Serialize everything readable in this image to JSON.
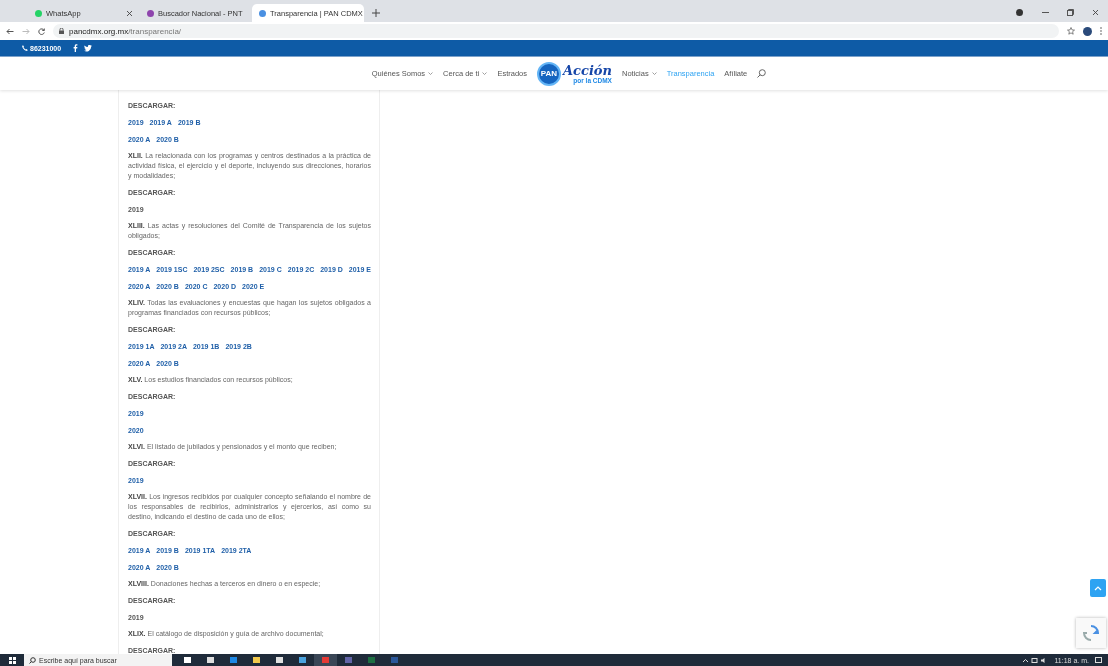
{
  "browser": {
    "tabs": [
      {
        "title": "WhatsApp",
        "selected": false
      },
      {
        "title": "Buscador Nacional - PNT",
        "selected": false
      },
      {
        "title": "Transparencia | PAN CDMX",
        "selected": true
      }
    ],
    "url_host": "pancdmx.org.mx",
    "url_path": "/transparencia/"
  },
  "topbar": {
    "phone": "86231000"
  },
  "nav": {
    "items": [
      {
        "label": "Quiénes Somos",
        "dropdown": true,
        "selected": false
      },
      {
        "label": "Cerca de ti",
        "dropdown": true,
        "selected": false
      },
      {
        "label": "Estrados",
        "dropdown": false,
        "selected": false
      },
      {
        "kind": "logo",
        "badge": "PAN",
        "script": "Acción",
        "tagline": "por la CDMX"
      },
      {
        "label": "Noticias",
        "dropdown": true,
        "selected": false
      },
      {
        "label": "Transparencia",
        "dropdown": false,
        "selected": true
      },
      {
        "label": "Afíliate",
        "dropdown": false,
        "selected": false
      }
    ]
  },
  "sections": [
    {
      "download_label": "DESCARGAR:",
      "rows": [
        [
          {
            "label": "2019",
            "linked": true
          },
          {
            "label": "2019 A",
            "linked": true
          },
          {
            "label": "2019 B",
            "linked": true
          }
        ],
        [
          {
            "label": "2020 A",
            "linked": true
          },
          {
            "label": "2020 B",
            "linked": true
          }
        ]
      ]
    },
    {
      "numeral": "XLII.",
      "text": "La relacionada con los programas y centros destinados a la práctica de actividad física, el ejercicio y el deporte, incluyendo sus direcciones, horarios y modalidades;",
      "download_label": "DESCARGAR:",
      "rows": [
        [
          {
            "label": "2019",
            "linked": false
          }
        ]
      ]
    },
    {
      "numeral": "XLIII.",
      "text": "Las actas y resoluciones del Comité de Transparencia de los sujetos obligados;",
      "download_label": "DESCARGAR:",
      "rows": [
        [
          {
            "label": "2019 A",
            "linked": true
          },
          {
            "label": "2019 1SC",
            "linked": true
          },
          {
            "label": "2019 2SC",
            "linked": true
          },
          {
            "label": "2019 B",
            "linked": true
          },
          {
            "label": "2019 C",
            "linked": true
          },
          {
            "label": "2019 2C",
            "linked": true
          },
          {
            "label": "2019 D",
            "linked": true
          },
          {
            "label": "2019 E",
            "linked": true
          }
        ],
        [
          {
            "label": "2020 A",
            "linked": true
          },
          {
            "label": "2020 B",
            "linked": true
          },
          {
            "label": "2020 C",
            "linked": true
          },
          {
            "label": "2020 D",
            "linked": true
          },
          {
            "label": "2020 E",
            "linked": true
          }
        ]
      ]
    },
    {
      "numeral": "XLIV.",
      "text": "Todas las evaluaciones y encuestas que hagan los sujetos obligados a programas financiados con recursos públicos;",
      "download_label": "DESCARGAR:",
      "rows": [
        [
          {
            "label": "2019 1A",
            "linked": true
          },
          {
            "label": "2019 2A",
            "linked": true
          },
          {
            "label": "2019 1B",
            "linked": true
          },
          {
            "label": "2019 2B",
            "linked": true
          }
        ],
        [
          {
            "label": "2020 A",
            "linked": true
          },
          {
            "label": "2020 B",
            "linked": true
          }
        ]
      ]
    },
    {
      "numeral": "XLV.",
      "text": "Los estudios financiados con recursos públicos;",
      "download_label": "DESCARGAR:",
      "rows": [
        [
          {
            "label": "2019",
            "linked": true
          }
        ],
        [
          {
            "label": "2020",
            "linked": true
          }
        ]
      ]
    },
    {
      "numeral": "XLVI.",
      "text": "El listado de jubilados y pensionados y el monto que reciben;",
      "download_label": "DESCARGAR:",
      "rows": [
        [
          {
            "label": "2019",
            "linked": true
          }
        ]
      ]
    },
    {
      "numeral": "XLVII.",
      "text": "Los ingresos recibidos por cualquier concepto señalando el nombre de los responsables de recibirlos, administrarlos y ejercerlos, así como su destino, indicando el destino de cada uno de ellos;",
      "download_label": "DESCARGAR:",
      "rows": [
        [
          {
            "label": "2019 A",
            "linked": true
          },
          {
            "label": "2019 B",
            "linked": true
          },
          {
            "label": "2019 1TA",
            "linked": true
          },
          {
            "label": "2019 2TA",
            "linked": true
          }
        ],
        [
          {
            "label": "2020 A",
            "linked": true
          },
          {
            "label": "2020 B",
            "linked": true
          }
        ]
      ]
    },
    {
      "numeral": "XLVIII.",
      "text": "Donaciones hechas a terceros en dinero o en especie;",
      "download_label": "DESCARGAR:",
      "rows": [
        [
          {
            "label": "2019",
            "linked": false
          }
        ]
      ]
    },
    {
      "numeral": "XLIX.",
      "text": "El catálogo de disposición y guía de archivo documental;",
      "download_label": "DESCARGAR:"
    }
  ],
  "taskbar": {
    "search_placeholder": "Escribe aquí para buscar",
    "time": "11:18 a. m."
  }
}
